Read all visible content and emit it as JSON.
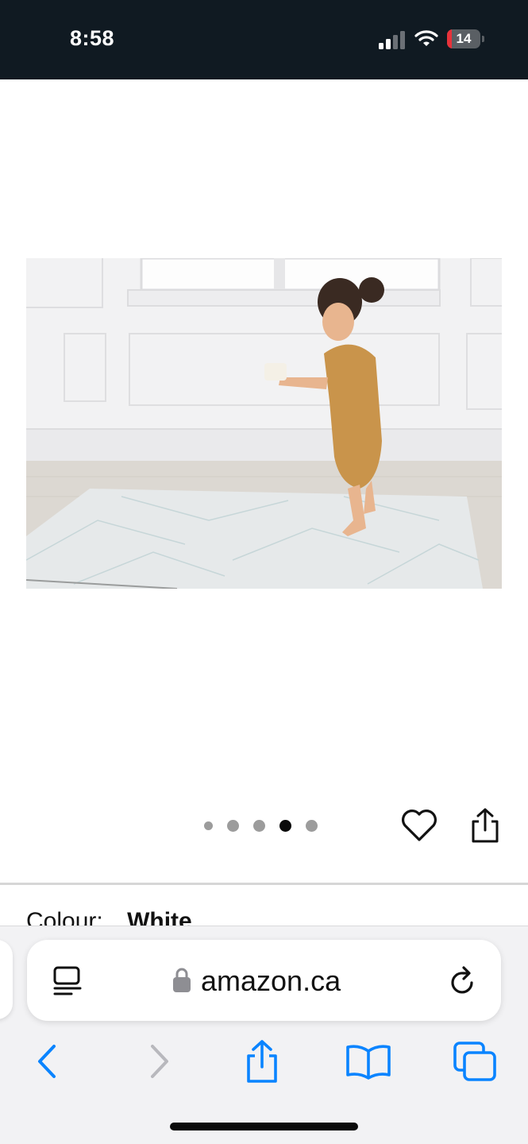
{
  "status_bar": {
    "time": "8:58",
    "battery_level": "14",
    "battery_fraction": 0.14,
    "battery_color": "#e8323a",
    "icons": [
      "cellular-signal-icon",
      "wifi-icon",
      "battery-icon"
    ]
  },
  "product": {
    "carousel": {
      "total_images": 5,
      "active_index": 3
    },
    "colour_label": "Colour:",
    "colour_value": "White"
  },
  "browser": {
    "url": "amazon.ca",
    "accent_color": "#0a84ff",
    "toolbar_icons": [
      "back-icon",
      "forward-icon",
      "share-icon",
      "bookmarks-icon",
      "tabs-icon"
    ]
  }
}
